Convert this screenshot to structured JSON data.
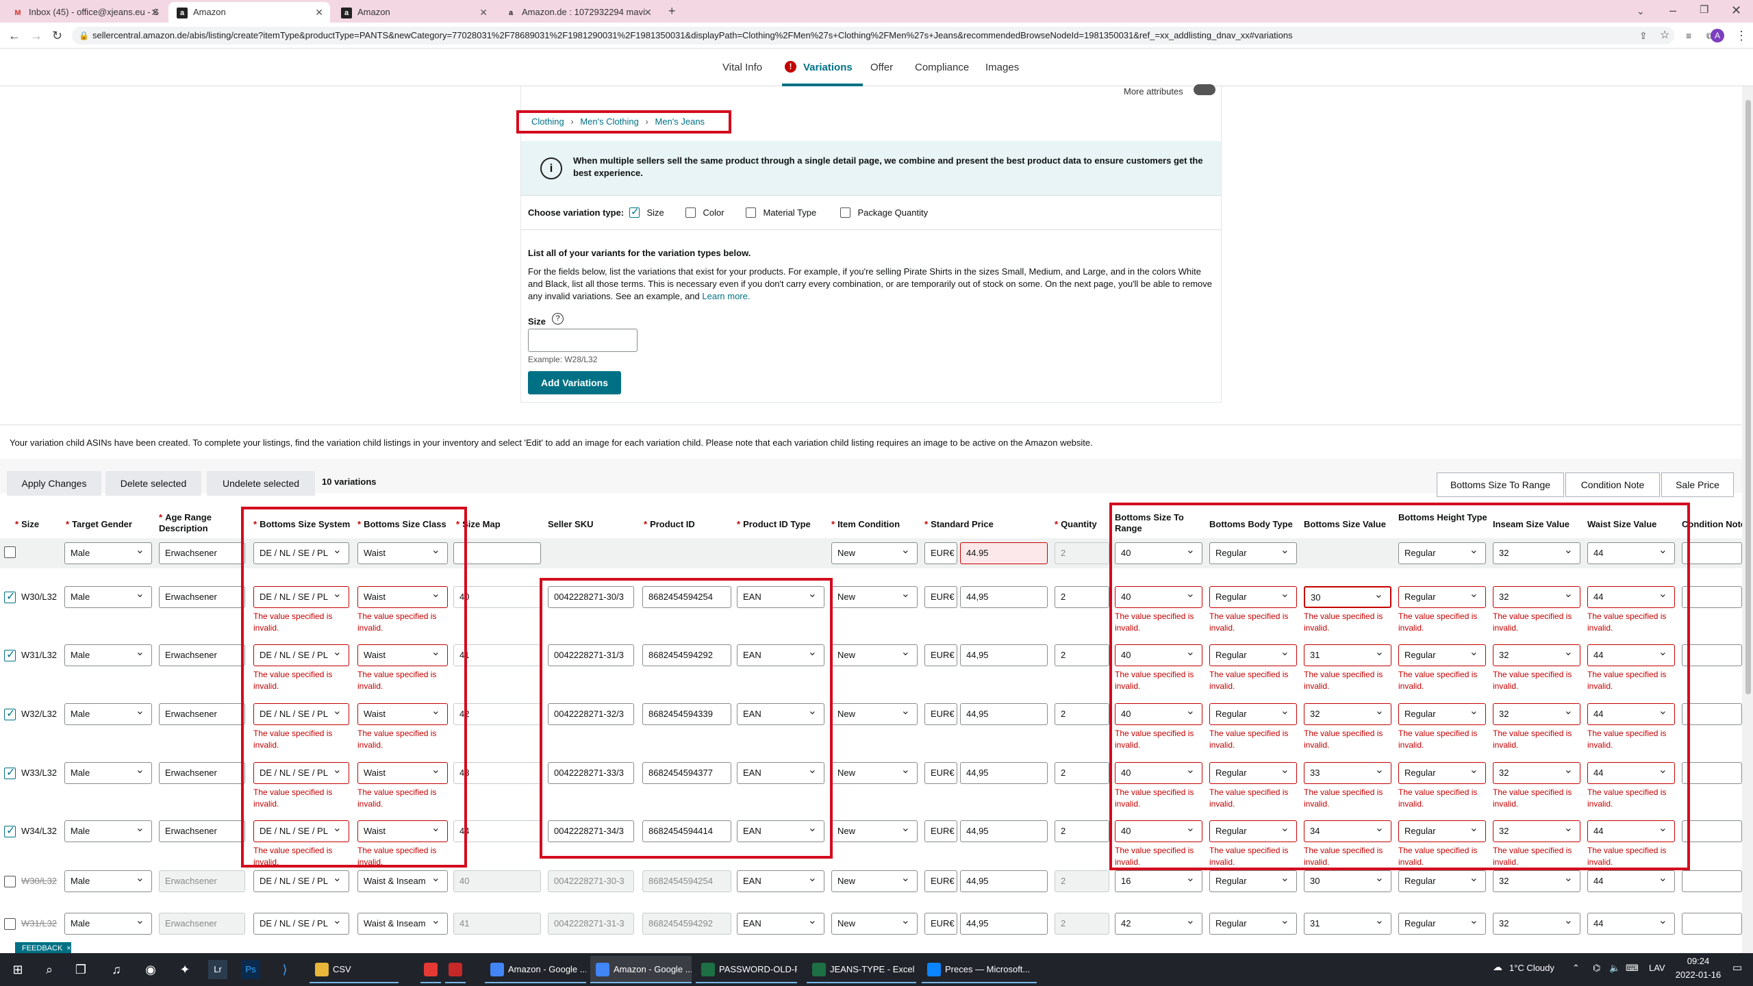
{
  "browser": {
    "tabs": [
      {
        "label": "Inbox (45) - office@xjeans.eu - S",
        "icon": "gmail-icon"
      },
      {
        "label": "Amazon",
        "icon": "amazon-icon"
      },
      {
        "label": "Amazon",
        "icon": "amazon-icon"
      },
      {
        "label": "Amazon.de : 1072932294 mavi",
        "icon": "amazon-icon"
      }
    ],
    "url": "sellercentral.amazon.de/abis/listing/create?itemType&productType=PANTS&newCategory=77028031%2F78689031%2F1981290031%2F1981350031&displayPath=Clothing%2FMen%27s+Clothing%2FMen%27s+Jeans&recommendedBrowseNodeId=1981350031&ref_=xx_addlisting_dnav_xx#variations",
    "profile": "A"
  },
  "subnav": {
    "tabs": [
      "Vital Info",
      "Variations",
      "Offer",
      "Compliance",
      "Images"
    ],
    "error_mark": "!"
  },
  "form": {
    "more_attributes": "More attributes",
    "breadcrumb": [
      "Clothing",
      "Men's Clothing",
      "Men's Jeans"
    ],
    "info_note": "When multiple sellers sell the same product through a single detail page, we combine and present the best product data to ensure customers get the best experience.",
    "variation_type_label": "Choose variation type:",
    "variation_types": [
      {
        "label": "Size",
        "checked": true
      },
      {
        "label": "Color",
        "checked": false
      },
      {
        "label": "Material Type",
        "checked": false
      },
      {
        "label": "Package Quantity",
        "checked": false
      }
    ],
    "list_heading": "List all of your variants for the variation types below.",
    "list_desc": "For the fields below, list the variations that exist for your products. For example, if you're selling Pirate Shirts in the sizes Small, Medium, and Large, and in the colors White and Black, list all those terms. This is necessary even if you don't carry every combination, or are temporarily out of stock on some. On the next page, you'll be able to remove any invalid variations. See an example, and",
    "learn_more": "Learn more.",
    "size_label": "Size",
    "help_icon": "?",
    "size_example": "Example: W28/L32",
    "add_variations": "Add Variations"
  },
  "variations": {
    "notice": "Your variation child ASINs have been created. To complete your listings, find the variation child listings in your inventory and select 'Edit' to add an image for each variation child. Please note that each variation child listing requires an image to be active on the Amazon website.",
    "apply_changes": "Apply Changes",
    "delete_selected": "Delete selected",
    "undelete_selected": "Undelete selected",
    "count": "10 variations",
    "right_buttons": [
      "Bottoms Size To Range",
      "Condition Note",
      "Sale Price"
    ],
    "required_mark": "*",
    "columns": {
      "size": "Size",
      "target_gender": "Target Gender",
      "age_range": "Age Range Description",
      "bss": "Bottoms Size System",
      "bsc": "Bottoms Size Class",
      "size_map": "Size Map",
      "seller_sku": "Seller SKU",
      "product_id": "Product ID",
      "product_id_type": "Product ID Type",
      "item_condition": "Item Condition",
      "standard_price": "Standard Price",
      "quantity": "Quantity",
      "bstr": "Bottoms Size To Range",
      "bbt": "Bottoms Body Type",
      "bsv": "Bottoms Size Value",
      "bht": "Bottoms Height Type",
      "isv": "Inseam Size Value",
      "wsv": "Waist Size Value",
      "cond_note": "Condition Note"
    },
    "error_text": "The value specified is invalid.",
    "currency": "EUR€",
    "master": {
      "gender": "Male",
      "age": "Erwachsener",
      "bss": "DE / NL / SE / PL",
      "bsc": "Waist",
      "size_map": "",
      "condition": "New",
      "price": "44.95",
      "qty": "2",
      "bstr": "40",
      "bbt": "Regular",
      "bht": "Regular",
      "isv": "32",
      "wsv": "44"
    },
    "rows": [
      {
        "size": "W30/L32",
        "gender": "Male",
        "age": "Erwachsener",
        "bss": "DE / NL / SE / PL",
        "bsc": "Waist",
        "size_map": "40",
        "sku": "0042228271-30/3",
        "pid": "8682454594254",
        "pid_type": "EAN",
        "condition": "New",
        "price": "44,95",
        "qty": "2",
        "bstr": "40",
        "bbt": "Regular",
        "bsv": "30",
        "bht": "Regular",
        "isv": "32",
        "wsv": "44"
      },
      {
        "size": "W31/L32",
        "gender": "Male",
        "age": "Erwachsener",
        "bss": "DE / NL / SE / PL",
        "bsc": "Waist",
        "size_map": "41",
        "sku": "0042228271-31/3",
        "pid": "8682454594292",
        "pid_type": "EAN",
        "condition": "New",
        "price": "44,95",
        "qty": "2",
        "bstr": "40",
        "bbt": "Regular",
        "bsv": "31",
        "bht": "Regular",
        "isv": "32",
        "wsv": "44"
      },
      {
        "size": "W32/L32",
        "gender": "Male",
        "age": "Erwachsener",
        "bss": "DE / NL / SE / PL",
        "bsc": "Waist",
        "size_map": "42",
        "sku": "0042228271-32/3",
        "pid": "8682454594339",
        "pid_type": "EAN",
        "condition": "New",
        "price": "44,95",
        "qty": "2",
        "bstr": "40",
        "bbt": "Regular",
        "bsv": "32",
        "bht": "Regular",
        "isv": "32",
        "wsv": "44"
      },
      {
        "size": "W33/L32",
        "gender": "Male",
        "age": "Erwachsener",
        "bss": "DE / NL / SE / PL",
        "bsc": "Waist",
        "size_map": "43",
        "sku": "0042228271-33/3",
        "pid": "8682454594377",
        "pid_type": "EAN",
        "condition": "New",
        "price": "44,95",
        "qty": "2",
        "bstr": "40",
        "bbt": "Regular",
        "bsv": "33",
        "bht": "Regular",
        "isv": "32",
        "wsv": "44"
      },
      {
        "size": "W34/L32",
        "gender": "Male",
        "age": "Erwachsener",
        "bss": "DE / NL / SE / PL",
        "bsc": "Waist",
        "size_map": "44",
        "sku": "0042228271-34/3",
        "pid": "8682454594414",
        "pid_type": "EAN",
        "condition": "New",
        "price": "44,95",
        "qty": "2",
        "bstr": "40",
        "bbt": "Regular",
        "bsv": "34",
        "bht": "Regular",
        "isv": "32",
        "wsv": "44"
      }
    ],
    "deleted_rows": [
      {
        "size": "W30/L32",
        "gender": "Male",
        "age": "Erwachsener",
        "bss": "DE / NL / SE / PL",
        "bsc": "Waist & Inseam",
        "size_map": "40",
        "sku": "0042228271-30-3",
        "pid": "8682454594254",
        "pid_type": "EAN",
        "condition": "New",
        "price": "44,95",
        "qty": "2",
        "bstr": "16",
        "bbt": "Regular",
        "bsv": "30",
        "bht": "Regular",
        "isv": "32",
        "wsv": "44"
      },
      {
        "size": "W31/L32",
        "gender": "Male",
        "age": "Erwachsener",
        "bss": "DE / NL / SE / PL",
        "bsc": "Waist & Inseam",
        "size_map": "41",
        "sku": "0042228271-31-3",
        "pid": "8682454594292",
        "pid_type": "EAN",
        "condition": "New",
        "price": "44,95",
        "qty": "2",
        "bstr": "42",
        "bbt": "Regular",
        "bsv": "31",
        "bht": "Regular",
        "isv": "32",
        "wsv": "44"
      }
    ]
  },
  "feedback": "FEEDBACK",
  "taskbar": {
    "apps": [
      {
        "label": "CSV",
        "color": "#e8b73a"
      },
      {
        "label": "",
        "color": "#e53935"
      },
      {
        "label": "",
        "color": "#c62828"
      },
      {
        "label": "Amazon - Google ...",
        "color": "#4285f4"
      },
      {
        "label": "Amazon - Google ...",
        "color": "#4285f4"
      },
      {
        "label": "PASSWORD-OLD-F...",
        "color": "#1d7044"
      },
      {
        "label": "JEANS-TYPE - Excel",
        "color": "#1d7044"
      },
      {
        "label": "Preces — Microsoft...",
        "color": "#0a84ff"
      }
    ],
    "weather": "1°C  Cloudy",
    "lang": "LAV",
    "time": "09:24",
    "date": "2022-01-16"
  },
  "colors": {
    "accent": "#007185",
    "error": "#c40000",
    "highlight_box": "#d40b1e"
  }
}
